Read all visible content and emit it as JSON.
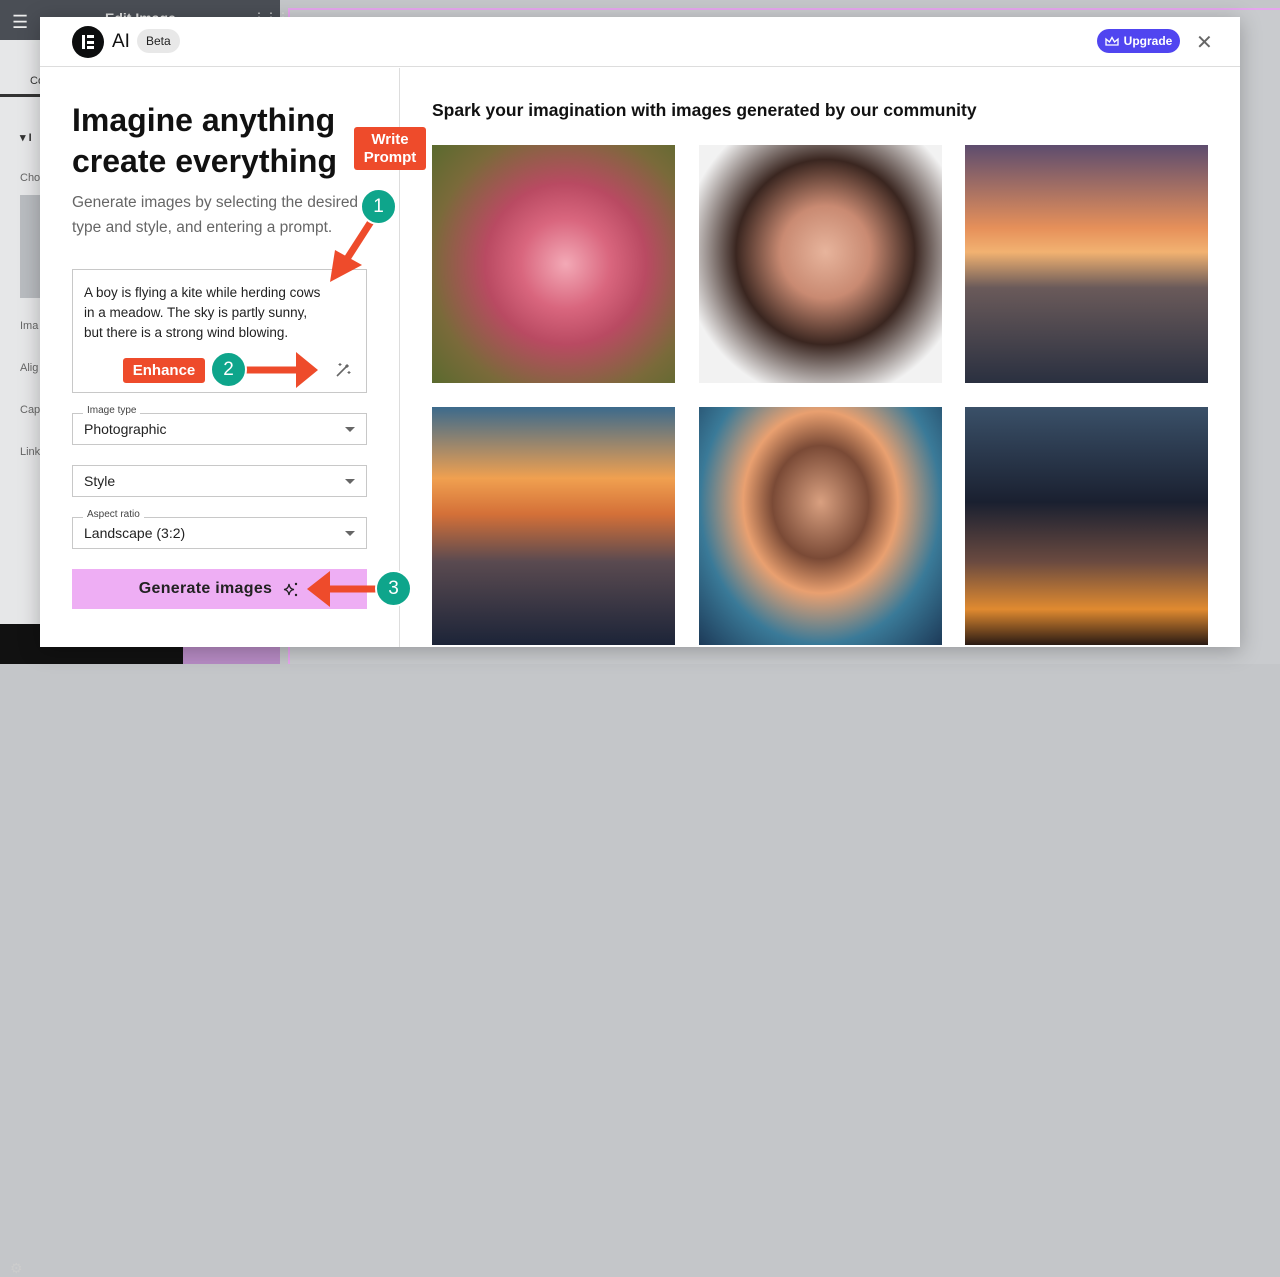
{
  "background_editor": {
    "title": "Edit Image",
    "tab": "Co",
    "section": "I",
    "labels": [
      "Cho",
      "Ima",
      "Alig",
      "Cap",
      "Link"
    ]
  },
  "header": {
    "brand": "AI",
    "badge": "Beta",
    "upgrade_label": "Upgrade",
    "upgrade_icon": "crown-icon",
    "close_icon": "close-icon"
  },
  "left": {
    "title": "Imagine anything create everything",
    "subtitle": "Generate images by selecting the desired type and style, and entering a prompt.",
    "prompt_value": "A boy is flying a kite while herding cows\nin a meadow. The sky is partly sunny,\nbut there is a strong wind blowing.",
    "image_type": {
      "label": "Image type",
      "value": "Photographic"
    },
    "style": {
      "value": "Style"
    },
    "aspect_ratio": {
      "label": "Aspect ratio",
      "value": "Landscape (3:2)"
    },
    "generate_label": "Generate images"
  },
  "right": {
    "title": "Spark your imagination with images generated by our community",
    "images": [
      "pink rose",
      "woman portrait",
      "elderly man at sunset",
      "mountain sunset",
      "young man with glasses",
      "city street at night"
    ]
  },
  "annotations": {
    "step1": {
      "number": "1",
      "label": "Write Prompt"
    },
    "step2": {
      "number": "2",
      "label": "Enhance"
    },
    "step3": {
      "number": "3"
    },
    "color_arrow": "#ee4b2b",
    "color_badge": "#0ea58b"
  },
  "colors": {
    "upgrade": "#5045f0",
    "generate": "#eeaef4"
  }
}
